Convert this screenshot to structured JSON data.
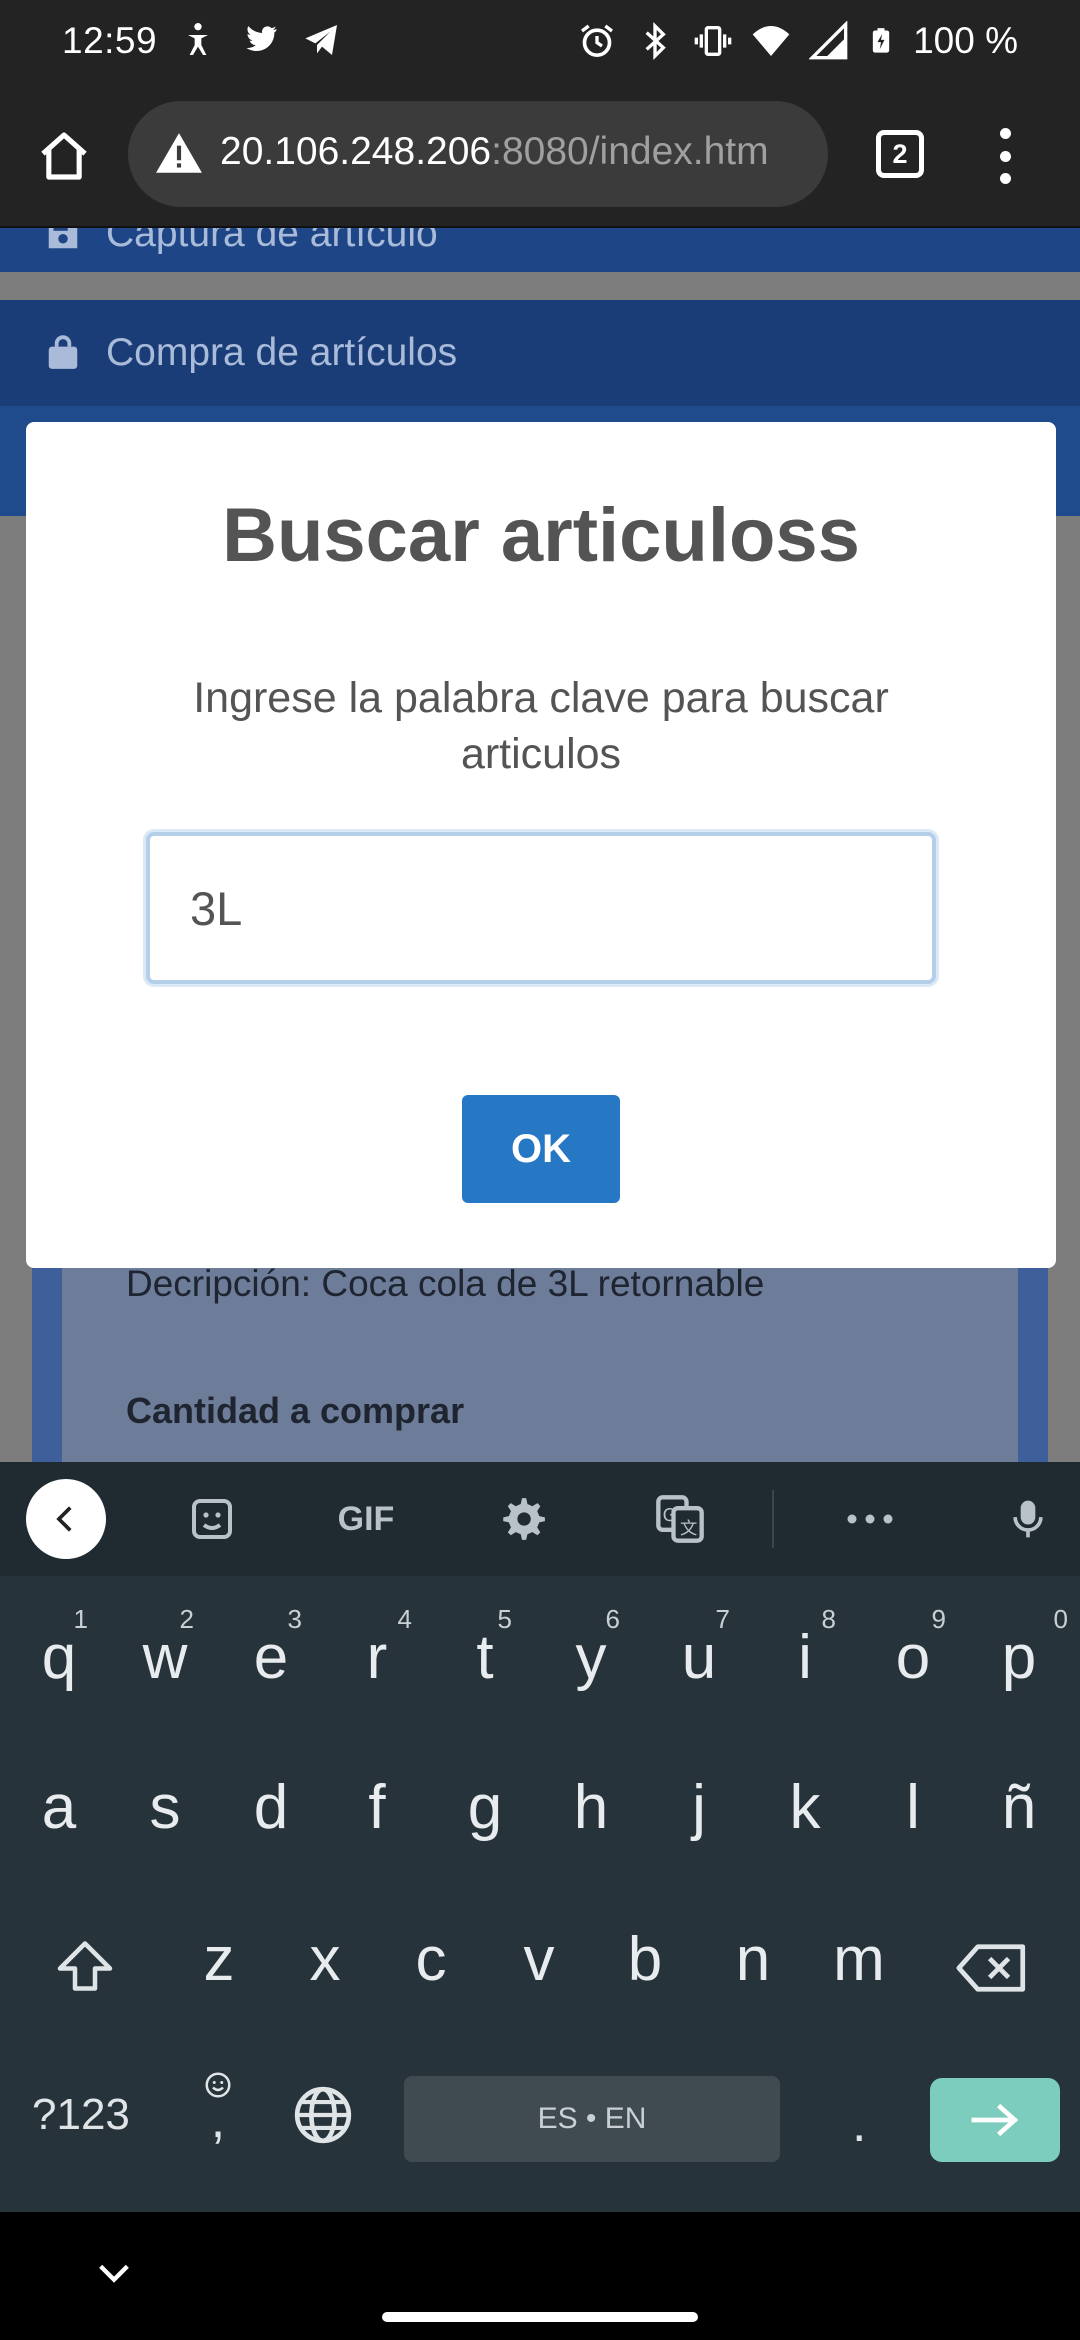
{
  "status_bar": {
    "time": "12:59",
    "battery_text": "100 %",
    "icons": [
      "accessibility-icon",
      "twitter-icon",
      "telegram-icon",
      "alarm-icon",
      "bluetooth-icon",
      "vibrate-icon",
      "wifi-icon",
      "signal-icon",
      "battery-charging-icon"
    ]
  },
  "browser": {
    "url_host": "20.106.248.206",
    "url_rest": ":8080/index.htm",
    "tab_count": "2"
  },
  "page": {
    "nav_items": [
      {
        "label": "Captura de artículo",
        "icon": "save-icon"
      },
      {
        "label": "Compra de artículos",
        "icon": "shopping-bag-icon"
      }
    ],
    "card_description": "Decripción: Coca cola de 3L retornable",
    "card_quantity_label": "Cantidad a comprar"
  },
  "modal": {
    "title": "Buscar articuloss",
    "text": "Ingrese la palabra clave para buscar articulos",
    "input_value": "3L",
    "ok_label": "OK"
  },
  "keyboard": {
    "toolbar": {
      "gif_label": "GIF"
    },
    "row1": [
      {
        "k": "q",
        "n": "1"
      },
      {
        "k": "w",
        "n": "2"
      },
      {
        "k": "e",
        "n": "3"
      },
      {
        "k": "r",
        "n": "4"
      },
      {
        "k": "t",
        "n": "5"
      },
      {
        "k": "y",
        "n": "6"
      },
      {
        "k": "u",
        "n": "7"
      },
      {
        "k": "i",
        "n": "8"
      },
      {
        "k": "o",
        "n": "9"
      },
      {
        "k": "p",
        "n": "0"
      }
    ],
    "row2": [
      "a",
      "s",
      "d",
      "f",
      "g",
      "h",
      "j",
      "k",
      "l",
      "ñ"
    ],
    "row3": [
      "z",
      "x",
      "c",
      "v",
      "b",
      "n",
      "m"
    ],
    "symbols_label": "?123",
    "emoji_comma": ",",
    "space_label": "ES • EN",
    "period": ".",
    "accent_color": "#7ccdbe"
  }
}
